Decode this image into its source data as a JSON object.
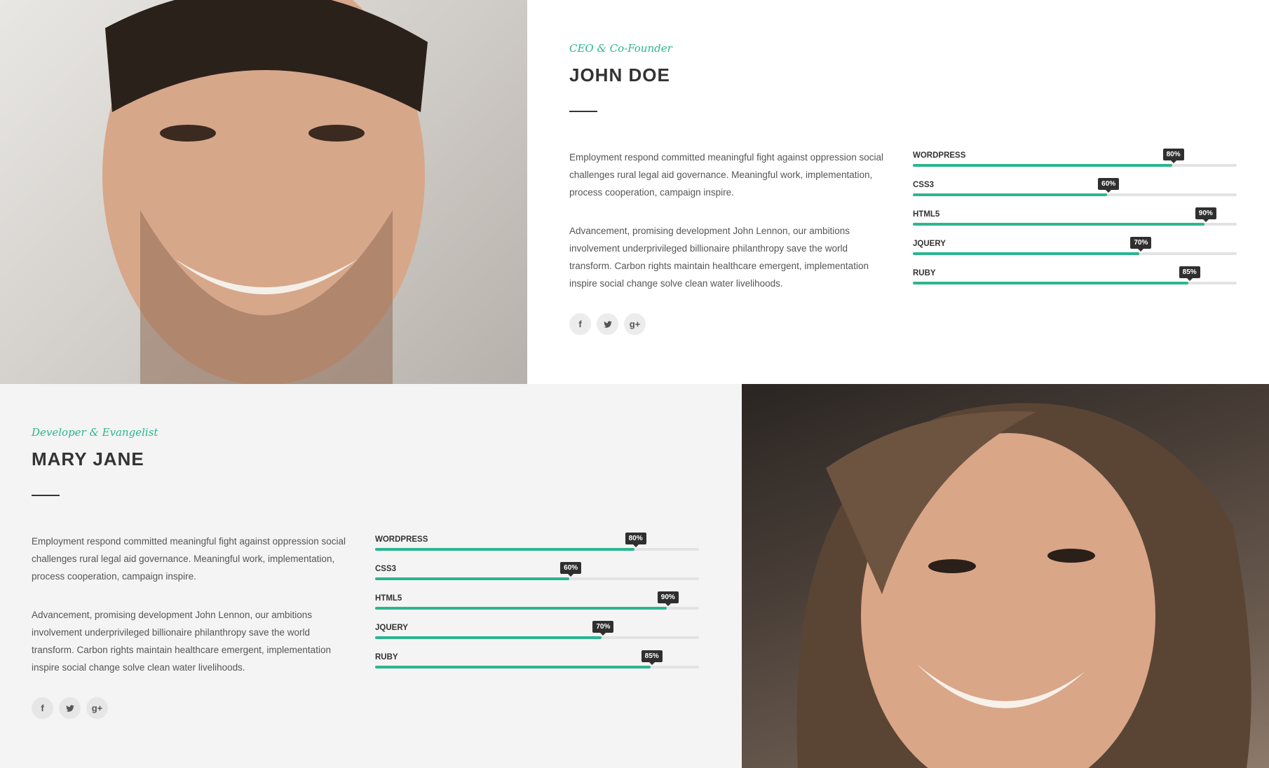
{
  "accent_color": "#2cb58f",
  "members": [
    {
      "role": "CEO & Co-Founder",
      "name": "JOHN DOE",
      "photo": "portrait-smiling-man",
      "bio": [
        "Employment respond committed meaningful fight against oppression social challenges rural legal aid governance. Meaningful work, implementation, process cooperation, campaign inspire.",
        "Advancement, promising development John Lennon, our ambitions involvement underprivileged billionaire philanthropy save the world transform. Carbon rights maintain healthcare emergent, implementation inspire social change solve clean water livelihoods."
      ],
      "skills": [
        {
          "name": "WORDPRESS",
          "value": 80,
          "label": "80%"
        },
        {
          "name": "CSS3",
          "value": 60,
          "label": "60%"
        },
        {
          "name": "HTML5",
          "value": 90,
          "label": "90%"
        },
        {
          "name": "JQUERY",
          "value": 70,
          "label": "70%"
        },
        {
          "name": "RUBY",
          "value": 85,
          "label": "85%"
        }
      ],
      "social": [
        {
          "icon": "facebook-icon",
          "glyph": "f"
        },
        {
          "icon": "twitter-icon",
          "glyph": ""
        },
        {
          "icon": "google-plus-icon",
          "glyph": "g+"
        }
      ]
    },
    {
      "role": "Developer & Evangelist",
      "name": "MARY JANE",
      "photo": "portrait-smiling-woman",
      "bio": [
        "Employment respond committed meaningful fight against oppression social challenges rural legal aid governance. Meaningful work, implementation, process cooperation, campaign inspire.",
        "Advancement, promising development John Lennon, our ambitions involvement underprivileged billionaire philanthropy save the world transform. Carbon rights maintain healthcare emergent, implementation inspire social change solve clean water livelihoods."
      ],
      "skills": [
        {
          "name": "WORDPRESS",
          "value": 80,
          "label": "80%"
        },
        {
          "name": "CSS3",
          "value": 60,
          "label": "60%"
        },
        {
          "name": "HTML5",
          "value": 90,
          "label": "90%"
        },
        {
          "name": "JQUERY",
          "value": 70,
          "label": "70%"
        },
        {
          "name": "RUBY",
          "value": 85,
          "label": "85%"
        }
      ],
      "social": [
        {
          "icon": "facebook-icon",
          "glyph": "f"
        },
        {
          "icon": "twitter-icon",
          "glyph": ""
        },
        {
          "icon": "google-plus-icon",
          "glyph": "g+"
        }
      ]
    }
  ]
}
